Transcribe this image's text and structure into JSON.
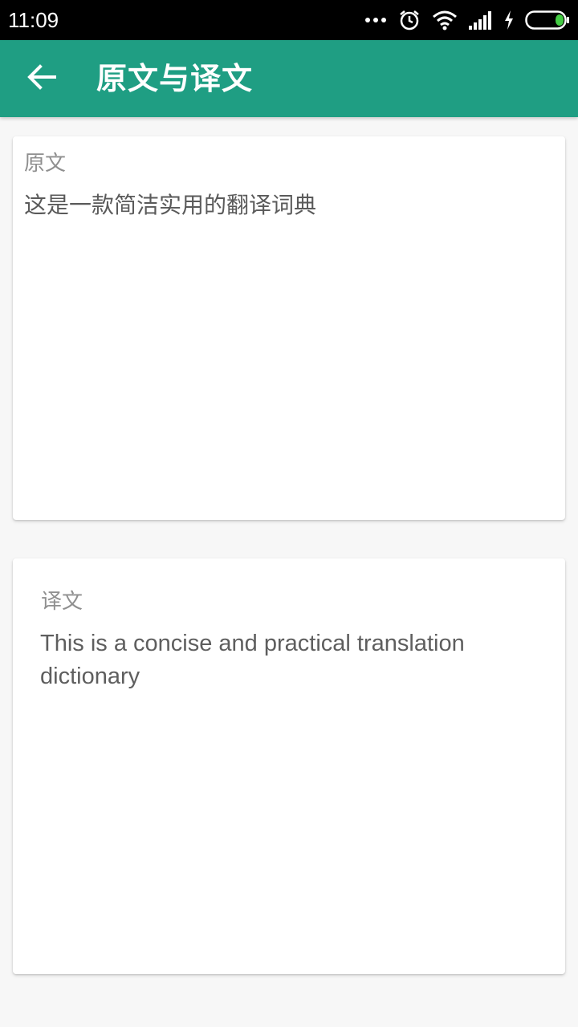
{
  "status_bar": {
    "time": "11:09",
    "icons": [
      "more-dots-icon",
      "alarm-icon",
      "wifi-icon",
      "signal-icon",
      "charging-icon",
      "battery-icon"
    ]
  },
  "app_bar": {
    "back_icon": "arrow-left-icon",
    "title": "原文与译文",
    "color": "#1f9e83"
  },
  "source_card": {
    "label": "原文",
    "text": "这是一款简洁实用的翻译词典"
  },
  "translation_card": {
    "label": "译文",
    "text": "This is a concise and practical translation dictionary"
  }
}
